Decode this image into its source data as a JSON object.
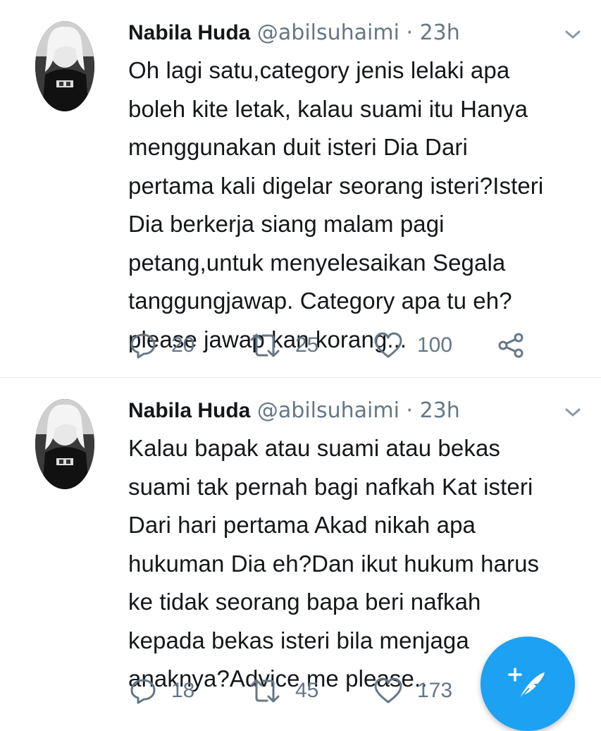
{
  "colors": {
    "accent": "#1da1f2",
    "muted": "#657786",
    "text": "#14171a",
    "divider": "#e1e8ed"
  },
  "tweets": [
    {
      "author_name": "Nabila Huda",
      "handle": "@abilsuhaimi",
      "separator": "·",
      "time": "23h",
      "lines": [
        "Oh lagi satu,category jenis lelaki apa",
        "boleh kite letak, kalau suami itu Hanya",
        "menggunakan duit isteri Dia Dari",
        "pertama kali digelar seorang isteri?Isteri",
        "Dia berkerja siang malam pagi",
        "petang,untuk menyelesaikan Segala",
        "tanggungjawap. Category apa tu eh?",
        "please jawap kan korang..."
      ],
      "replies": "20",
      "retweets": "25",
      "likes": "100",
      "icons": {
        "reply": "reply-icon",
        "retweet": "retweet-icon",
        "like": "heart-icon",
        "share": "share-icon"
      }
    },
    {
      "author_name": "Nabila Huda",
      "handle": "@abilsuhaimi",
      "separator": "·",
      "time": "23h",
      "lines": [
        "Kalau bapak atau suami atau bekas",
        "suami tak pernah bagi nafkah Kat isteri",
        "Dari hari pertama Akad nikah apa",
        "hukuman Dia eh?Dan ikut hukum harus",
        "ke tidak seorang bapa beri nafkah",
        "kepada bekas isteri bila menjaga",
        "anaknya?Advice me please.."
      ],
      "replies": "18",
      "retweets": "45",
      "likes": "173",
      "icons": {
        "reply": "reply-icon",
        "retweet": "retweet-icon",
        "like": "heart-icon"
      }
    }
  ],
  "fab": {
    "icon": "compose-tweet-icon"
  }
}
